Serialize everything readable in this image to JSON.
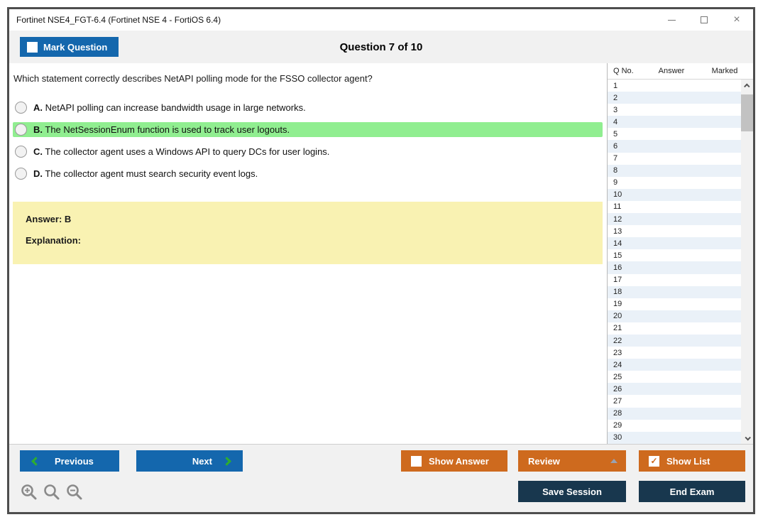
{
  "window": {
    "title": "Fortinet NSE4_FGT-6.4 (Fortinet NSE 4 - FortiOS 6.4)",
    "controls": {
      "close_glyph": "×"
    }
  },
  "header": {
    "mark_question_label": "Mark Question",
    "question_counter": "Question 7 of 10"
  },
  "question": {
    "text": "Which statement correctly describes NetAPI polling mode for the FSSO collector agent?",
    "options": [
      {
        "letter": "A.",
        "text": "NetAPI polling can increase bandwidth usage in large networks.",
        "highlighted": false
      },
      {
        "letter": "B.",
        "text": "The NetSessionEnum function is used to track user logouts.",
        "highlighted": true
      },
      {
        "letter": "C.",
        "text": "The collector agent uses a Windows API to query DCs for user logins.",
        "highlighted": false
      },
      {
        "letter": "D.",
        "text": "The collector agent must search security event logs.",
        "highlighted": false
      }
    ],
    "answer_label": "Answer: B",
    "explanation_label": "Explanation:"
  },
  "sidebar": {
    "columns": [
      "Q No.",
      "Answer",
      "Marked"
    ],
    "rows": [
      {
        "q": "1",
        "answer": "",
        "marked": ""
      },
      {
        "q": "2",
        "answer": "",
        "marked": ""
      },
      {
        "q": "3",
        "answer": "",
        "marked": ""
      },
      {
        "q": "4",
        "answer": "",
        "marked": ""
      },
      {
        "q": "5",
        "answer": "",
        "marked": ""
      },
      {
        "q": "6",
        "answer": "",
        "marked": ""
      },
      {
        "q": "7",
        "answer": "",
        "marked": ""
      },
      {
        "q": "8",
        "answer": "",
        "marked": ""
      },
      {
        "q": "9",
        "answer": "",
        "marked": ""
      },
      {
        "q": "10",
        "answer": "",
        "marked": ""
      },
      {
        "q": "11",
        "answer": "",
        "marked": ""
      },
      {
        "q": "12",
        "answer": "",
        "marked": ""
      },
      {
        "q": "13",
        "answer": "",
        "marked": ""
      },
      {
        "q": "14",
        "answer": "",
        "marked": ""
      },
      {
        "q": "15",
        "answer": "",
        "marked": ""
      },
      {
        "q": "16",
        "answer": "",
        "marked": ""
      },
      {
        "q": "17",
        "answer": "",
        "marked": ""
      },
      {
        "q": "18",
        "answer": "",
        "marked": ""
      },
      {
        "q": "19",
        "answer": "",
        "marked": ""
      },
      {
        "q": "20",
        "answer": "",
        "marked": ""
      },
      {
        "q": "21",
        "answer": "",
        "marked": ""
      },
      {
        "q": "22",
        "answer": "",
        "marked": ""
      },
      {
        "q": "23",
        "answer": "",
        "marked": ""
      },
      {
        "q": "24",
        "answer": "",
        "marked": ""
      },
      {
        "q": "25",
        "answer": "",
        "marked": ""
      },
      {
        "q": "26",
        "answer": "",
        "marked": ""
      },
      {
        "q": "27",
        "answer": "",
        "marked": ""
      },
      {
        "q": "28",
        "answer": "",
        "marked": ""
      },
      {
        "q": "29",
        "answer": "",
        "marked": ""
      },
      {
        "q": "30",
        "answer": "",
        "marked": ""
      }
    ]
  },
  "footer": {
    "previous_label": "Previous",
    "next_label": "Next",
    "show_answer_label": "Show Answer",
    "review_label": "Review",
    "show_list_label": "Show List",
    "save_session_label": "Save Session",
    "end_exam_label": "End Exam"
  },
  "icons": {
    "check_glyph": "✓"
  },
  "colors": {
    "accent_blue": "#1467AD",
    "accent_orange": "#CE6A1E",
    "dark_navy": "#18374E",
    "highlight_green": "#90EE90",
    "answer_yellow": "#F9F2B2",
    "row_alt_blue": "#EAF1F8"
  }
}
